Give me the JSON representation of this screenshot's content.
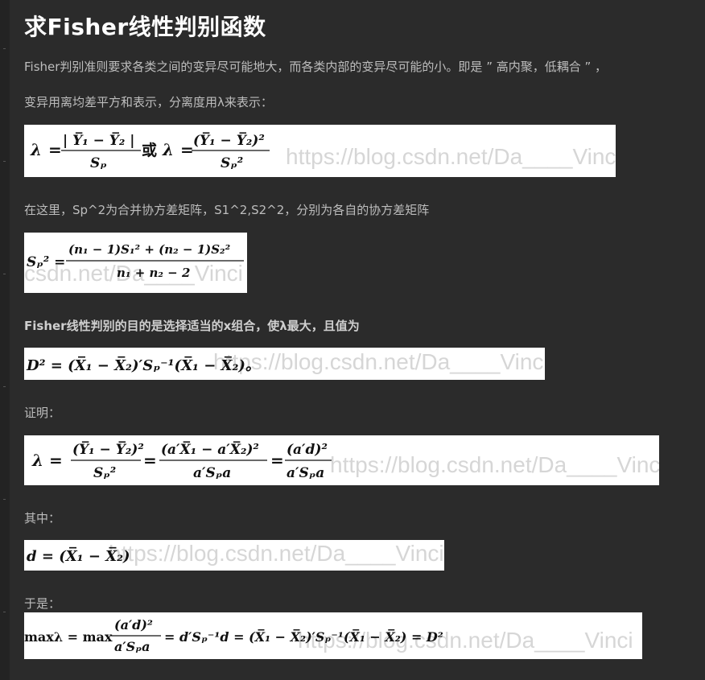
{
  "title": "求Fisher线性判别函数",
  "paragraphs": {
    "p1": "Fisher判别准则要求各类之间的变异尽可能地大，而各类内部的变异尽可能的小。即是 ” 高内聚，低耦合 ” ，",
    "p2": "变异用离均差平方和表示，分离度用λ来表示：",
    "p3": "在这里，Sp^2为合并协方差矩阵，S1^2,S2^2，分别为各自的协方差矩阵",
    "p4": "Fisher线性判别的目的是选择适当的x组合，使λ最大，且值为",
    "p5": "证明：",
    "p6": "其中：",
    "p7": "于是："
  },
  "watermark": "https://blog.csdn.net/Da____Vinci",
  "watermark_partial": "csdn.net/Da____Vinci",
  "equations": {
    "eq1": {
      "lambda": "λ",
      "eq": "=",
      "num1": "| Y̅₁ − Y̅₂ |",
      "den1": "Sₚ",
      "or": "或",
      "num2": "(Y̅₁ − Y̅₂)²",
      "den2": "Sₚ²"
    },
    "eq2": {
      "lhs": "Sₚ² =",
      "num": "(n₁ − 1)S₁² + (n₂ − 1)S₂²",
      "den": "n₁ + n₂ − 2"
    },
    "eq3": {
      "text": "D² = (X̅₁ − X̅₂)′Sₚ⁻¹(X̅₁ − X̅₂)。"
    },
    "eq4": {
      "lhs": "λ =",
      "num1": "(Y̅₁ − Y̅₂)²",
      "den1": "Sₚ²",
      "eq": "=",
      "num2": "(a′X̅₁ − a′X̅₂)²",
      "den2": "a′Sₚa",
      "num3": "(a′d)²",
      "den3": "a′Sₚa"
    },
    "eq5": {
      "text": "d = (X̅₁ − X̅₂)"
    },
    "eq6": {
      "lhs": "maxλ = max",
      "num": "(a′d)²",
      "den": "a′Sₚa",
      "rhs": "= d′Sₚ⁻¹d = (X̅₁ − X̅₂)′Sₚ⁻¹(X̅₁ − X̅₂) = D²"
    }
  }
}
